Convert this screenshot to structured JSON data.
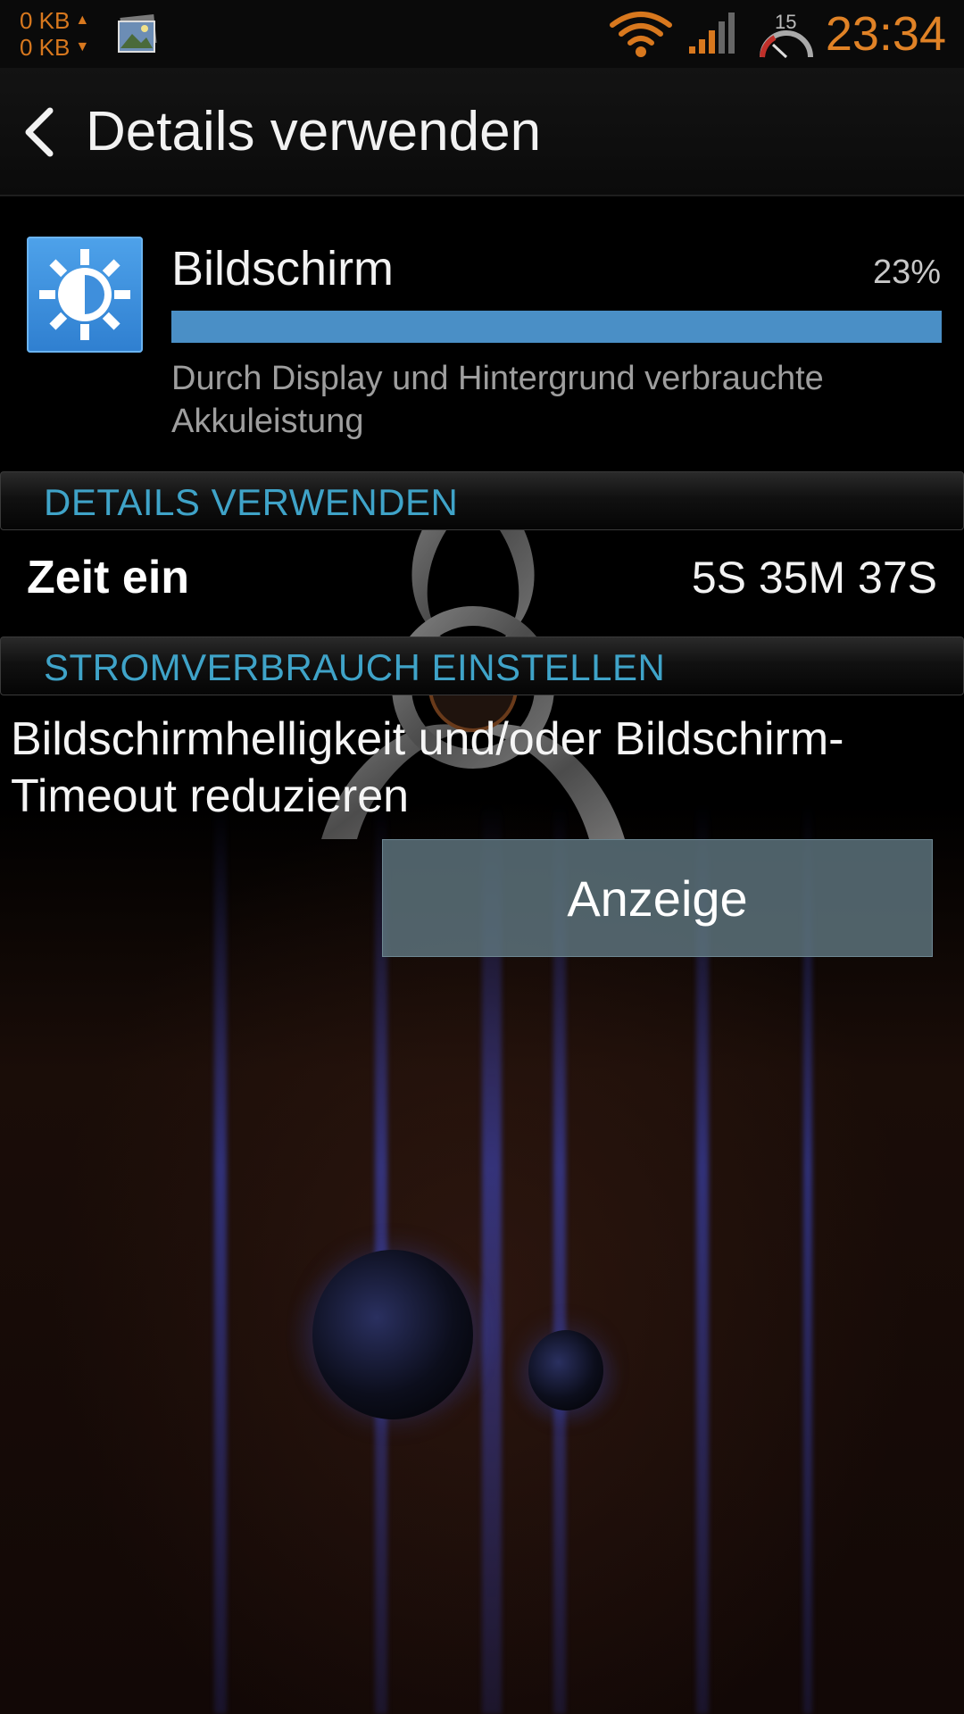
{
  "status_bar": {
    "upload": "0 KB",
    "download": "0 KB",
    "speed_badge": "15",
    "time": "23:34",
    "accent_color": "#e08226"
  },
  "header": {
    "title": "Details verwenden",
    "back_icon": "chevron-left-icon"
  },
  "app_usage": {
    "icon": "gear-brightness-icon",
    "name": "Bildschirm",
    "percent_label": "23%",
    "usage_fraction": 0.23,
    "description": "Durch Display und Hintergrund verbrauchte Akkuleistung",
    "bar_color": "#4a8fc6"
  },
  "details_section": {
    "header": "DETAILS VERWENDEN",
    "rows": [
      {
        "label": "Zeit ein",
        "value": "5S 35M 37S"
      }
    ]
  },
  "power_section": {
    "header": "STROMVERBRAUCH EINSTELLEN",
    "text": "Bildschirmhelligkeit und/oder Bildschirm-Timeout reduzieren",
    "button_label": "Anzeige",
    "header_color": "#3fa3c8"
  }
}
